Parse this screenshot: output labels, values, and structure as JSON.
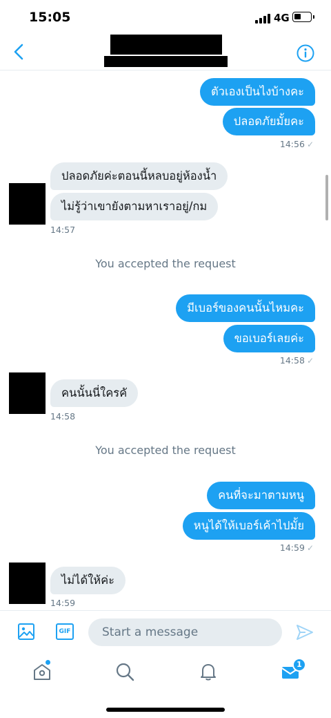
{
  "status_bar": {
    "time": "15:05",
    "network": "4G"
  },
  "header": {
    "back_icon": "chevron-left-icon",
    "info_icon": "info-icon"
  },
  "messages": [
    {
      "direction": "out",
      "text": "ตัวเองเป็นไงบ้างคะ"
    },
    {
      "direction": "out",
      "text": "ปลอดภัยมั้ยคะ"
    },
    {
      "direction": "out_ts",
      "text": "14:56"
    },
    {
      "direction": "in",
      "text": "ปลอดภัยค่ะตอนนี้หลบอยู่ห้องน้ำ"
    },
    {
      "direction": "in",
      "text": "ไม่รู้ว่าเขายังตามหาเราอยู่/กม"
    },
    {
      "direction": "in_ts",
      "text": "14:57"
    },
    {
      "direction": "system",
      "text": "You accepted the request"
    },
    {
      "direction": "out",
      "text": "มีเบอร์ของคนนั้นไหมคะ"
    },
    {
      "direction": "out",
      "text": "ขอเบอร์เลยค่ะ"
    },
    {
      "direction": "out_ts",
      "text": "14:58"
    },
    {
      "direction": "in",
      "text": "คนนั้นนี่ใครคั"
    },
    {
      "direction": "in_ts",
      "text": "14:58"
    },
    {
      "direction": "system",
      "text": "You accepted the request"
    },
    {
      "direction": "out",
      "text": "คนที่จะมาตามหนู"
    },
    {
      "direction": "out",
      "text": "หนูได้ให้เบอร์เค้าไปมั้ย"
    },
    {
      "direction": "out_ts",
      "text": "14:59"
    },
    {
      "direction": "in",
      "text": "ไม่ได้ให้ค่ะ"
    },
    {
      "direction": "in_ts",
      "text": "14:59"
    }
  ],
  "composer": {
    "placeholder": "Start a message",
    "gif_label": "GIF",
    "media_icon": "image-icon",
    "send_icon": "send-icon"
  },
  "tabbar": {
    "home_icon": "home-icon",
    "search_icon": "search-icon",
    "notifications_icon": "bell-icon",
    "messages_icon": "mail-icon",
    "messages_badge": "1"
  },
  "colors": {
    "accent": "#1da1f2",
    "incoming_bubble": "#e6ecf0",
    "muted": "#657786"
  }
}
